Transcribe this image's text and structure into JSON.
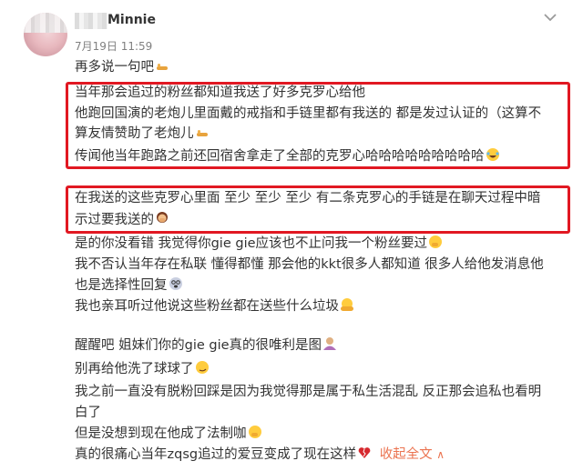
{
  "post": {
    "username": "Minnie",
    "timestamp": "7月19日 11:59",
    "paragraphs": [
      "再多说一句吧",
      "当年那会追过的粉丝都知道我送了好多克罗心给他",
      "他跑回国演的老炮儿里面戴的戒指和手链里都有我送的 都是发过认证的（这算不",
      "算友情赞助了老炮儿",
      "传闻他当年跑路之前还回宿舍拿走了全部的克罗心哈哈哈哈哈哈哈哈哈",
      "在我送的这些克罗心里面 至少 至少 至少 有二条克罗心的手链是在聊天过程中暗",
      "示过要我送的",
      "是的你没看错 我觉得你gie gie应该也不止问我一个粉丝要过",
      "我不否认当年存在私联 懂得都懂 那会他的kkt很多人都知道 很多人给他发消息他",
      "也是选择性回复",
      "我也亲耳听过他说这些粉丝都在送些什么垃圾",
      "醒醒吧 姐妹们你的gie gie真的很唯利是图",
      "别再给他洗了球球了",
      "我之前一直没有脱粉回踩是因为我觉得那是属于私生活混乱 反正那会追私也看明",
      "白了",
      "但是没想到现在他成了法制咖",
      "真的很痛心当年zqsg追过的爱豆变成了现在这样"
    ],
    "collapse_label": "收起全文",
    "collapse_icon": "chevron-up-icon"
  },
  "colors": {
    "highlight_box": "#e11822",
    "link": "#eb7350",
    "meta": "#808080"
  }
}
